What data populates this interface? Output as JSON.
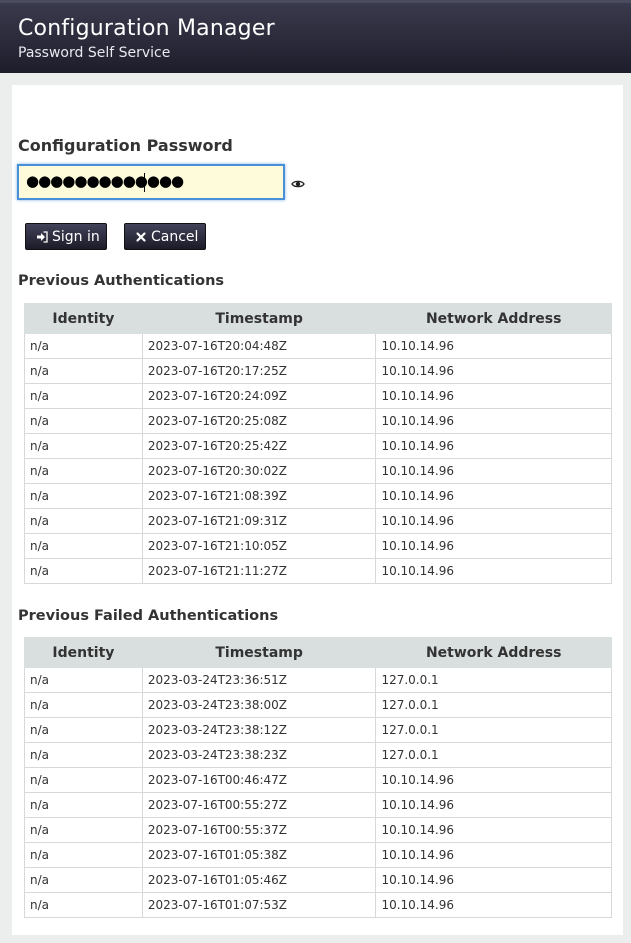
{
  "header": {
    "title": "Configuration Manager",
    "subtitle": "Password Self Service"
  },
  "login": {
    "heading": "Configuration Password",
    "password_masked": "●●●●●●●●●●●●●",
    "signin_label": "Sign in",
    "cancel_label": "Cancel"
  },
  "icons": [
    "eye-icon",
    "sign-in-icon",
    "cancel-x-icon"
  ],
  "colors": {
    "header_bg": "#1d1d2b",
    "field_bg": "#fdfbd9",
    "field_focus_border": "#4a90d9",
    "table_header_bg": "#d9dfdf"
  },
  "previous": {
    "heading": "Previous Authentications",
    "columns": [
      "Identity",
      "Timestamp",
      "Network Address"
    ],
    "rows": [
      [
        "n/a",
        "2023-07-16T20:04:48Z",
        "10.10.14.96"
      ],
      [
        "n/a",
        "2023-07-16T20:17:25Z",
        "10.10.14.96"
      ],
      [
        "n/a",
        "2023-07-16T20:24:09Z",
        "10.10.14.96"
      ],
      [
        "n/a",
        "2023-07-16T20:25:08Z",
        "10.10.14.96"
      ],
      [
        "n/a",
        "2023-07-16T20:25:42Z",
        "10.10.14.96"
      ],
      [
        "n/a",
        "2023-07-16T20:30:02Z",
        "10.10.14.96"
      ],
      [
        "n/a",
        "2023-07-16T21:08:39Z",
        "10.10.14.96"
      ],
      [
        "n/a",
        "2023-07-16T21:09:31Z",
        "10.10.14.96"
      ],
      [
        "n/a",
        "2023-07-16T21:10:05Z",
        "10.10.14.96"
      ],
      [
        "n/a",
        "2023-07-16T21:11:27Z",
        "10.10.14.96"
      ]
    ]
  },
  "failed": {
    "heading": "Previous Failed Authentications",
    "columns": [
      "Identity",
      "Timestamp",
      "Network Address"
    ],
    "rows": [
      [
        "n/a",
        "2023-03-24T23:36:51Z",
        "127.0.0.1"
      ],
      [
        "n/a",
        "2023-03-24T23:38:00Z",
        "127.0.0.1"
      ],
      [
        "n/a",
        "2023-03-24T23:38:12Z",
        "127.0.0.1"
      ],
      [
        "n/a",
        "2023-03-24T23:38:23Z",
        "127.0.0.1"
      ],
      [
        "n/a",
        "2023-07-16T00:46:47Z",
        "10.10.14.96"
      ],
      [
        "n/a",
        "2023-07-16T00:55:27Z",
        "10.10.14.96"
      ],
      [
        "n/a",
        "2023-07-16T00:55:37Z",
        "10.10.14.96"
      ],
      [
        "n/a",
        "2023-07-16T01:05:38Z",
        "10.10.14.96"
      ],
      [
        "n/a",
        "2023-07-16T01:05:46Z",
        "10.10.14.96"
      ],
      [
        "n/a",
        "2023-07-16T01:07:53Z",
        "10.10.14.96"
      ]
    ]
  }
}
